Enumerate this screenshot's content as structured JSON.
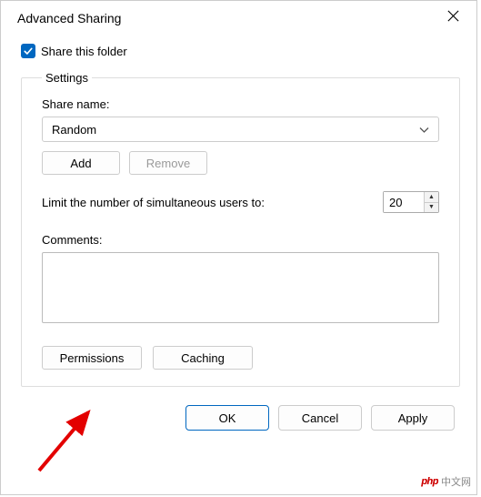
{
  "dialog": {
    "title": "Advanced Sharing"
  },
  "share_checkbox": {
    "label": "Share this folder",
    "checked": true
  },
  "settings": {
    "legend": "Settings",
    "share_name_label": "Share name:",
    "share_name_value": "Random",
    "add_label": "Add",
    "remove_label": "Remove",
    "limit_label": "Limit the number of simultaneous users to:",
    "limit_value": "20",
    "comments_label": "Comments:",
    "comments_value": "",
    "permissions_label": "Permissions",
    "caching_label": "Caching"
  },
  "footer": {
    "ok": "OK",
    "cancel": "Cancel",
    "apply": "Apply"
  },
  "watermark": {
    "logo": "php",
    "text": "中文网"
  }
}
